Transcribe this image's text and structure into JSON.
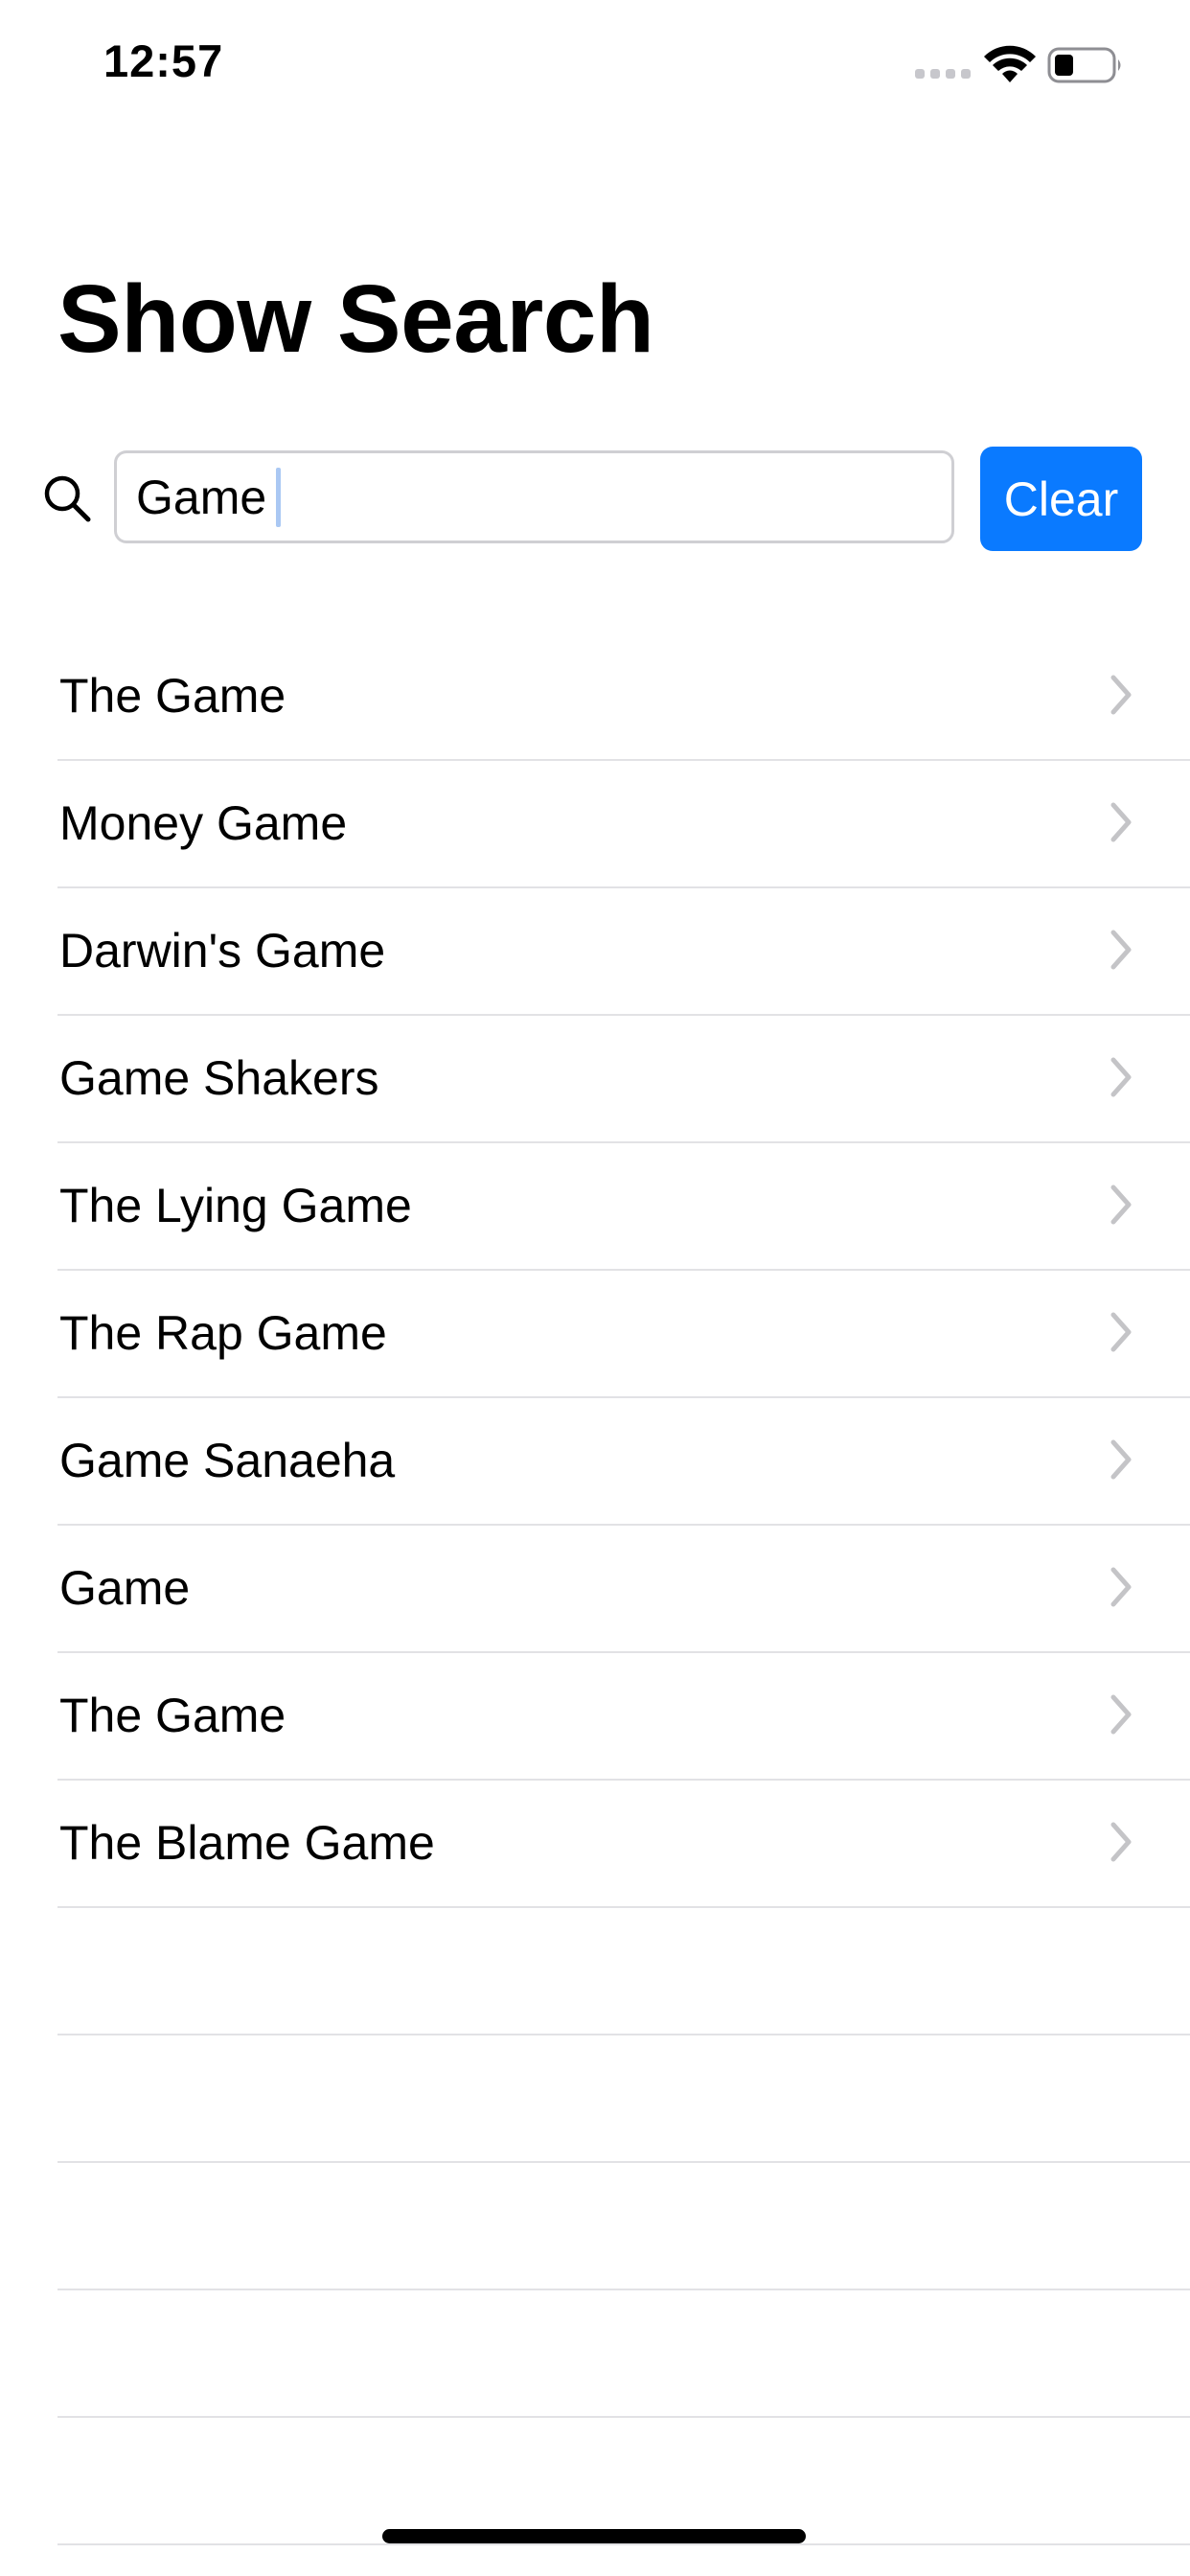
{
  "status_bar": {
    "time": "12:57"
  },
  "icons": {
    "search": "search-icon",
    "chevron": "chevron-right-icon",
    "wifi": "wifi-icon",
    "battery": "battery-icon",
    "signal": "signal-icon"
  },
  "colors": {
    "accent": "#0a7aff",
    "separator": "#e2e2e5",
    "chevron": "#c4c4c7",
    "caret": "#aac8f3"
  },
  "header": {
    "title": "Show Search"
  },
  "search": {
    "value": "Game",
    "clear_label": "Clear"
  },
  "results": [
    {
      "title": "The Game"
    },
    {
      "title": "Money Game"
    },
    {
      "title": "Darwin's Game"
    },
    {
      "title": "Game Shakers"
    },
    {
      "title": "The Lying Game"
    },
    {
      "title": "The Rap Game"
    },
    {
      "title": "Game Sanaeha"
    },
    {
      "title": "Game"
    },
    {
      "title": "The Game"
    },
    {
      "title": "The Blame Game"
    }
  ],
  "empty_rows": 5
}
